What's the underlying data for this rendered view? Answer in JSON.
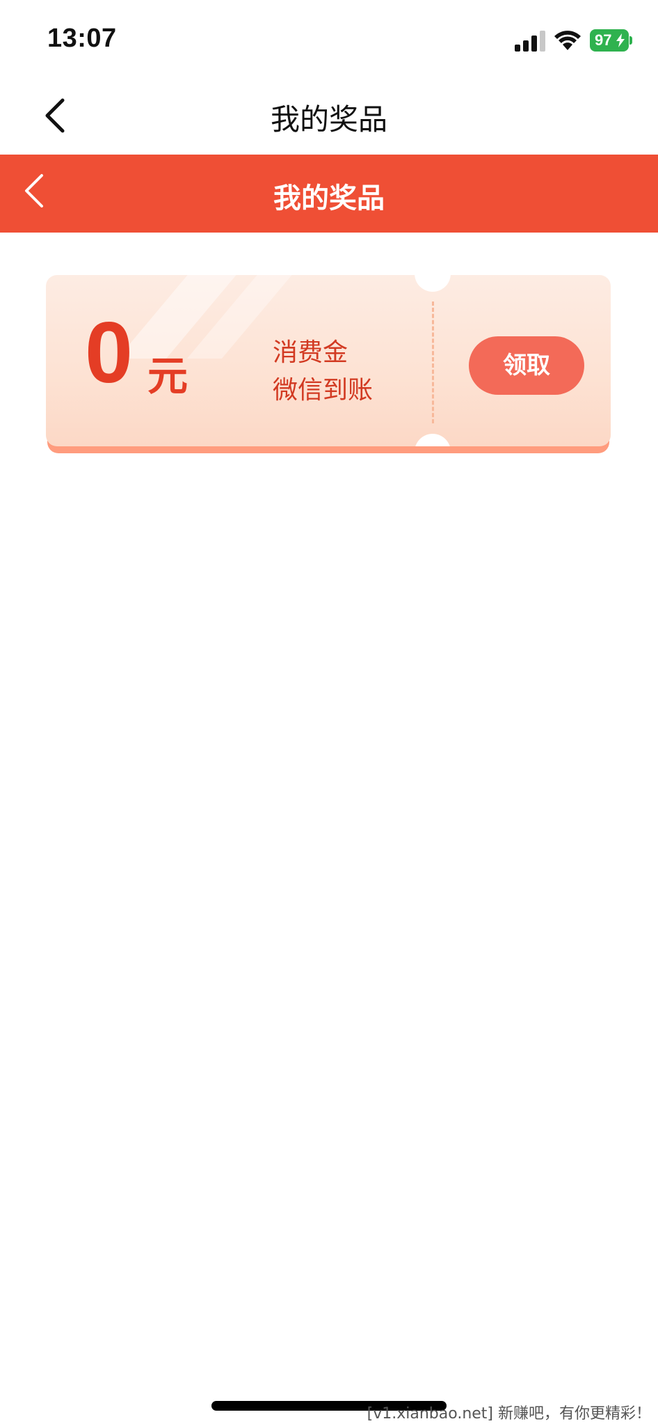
{
  "status_bar": {
    "time": "13:07",
    "battery_level": "97",
    "battery_color": "#2fb24f"
  },
  "nav": {
    "title": "我的奖品",
    "back_icon": "chevron-left-icon"
  },
  "header": {
    "title": "我的奖品",
    "background_color": "#ef4f35",
    "back_icon": "chevron-left-icon"
  },
  "coupon": {
    "amount": "0",
    "unit": "元",
    "line1": "消费金",
    "line2": "微信到账",
    "claim_label": "领取",
    "accent_color": "#e43d25",
    "button_color": "#f36a58"
  },
  "watermark": "[v1.xianbao.net] 新赚吧，有你更精彩！"
}
